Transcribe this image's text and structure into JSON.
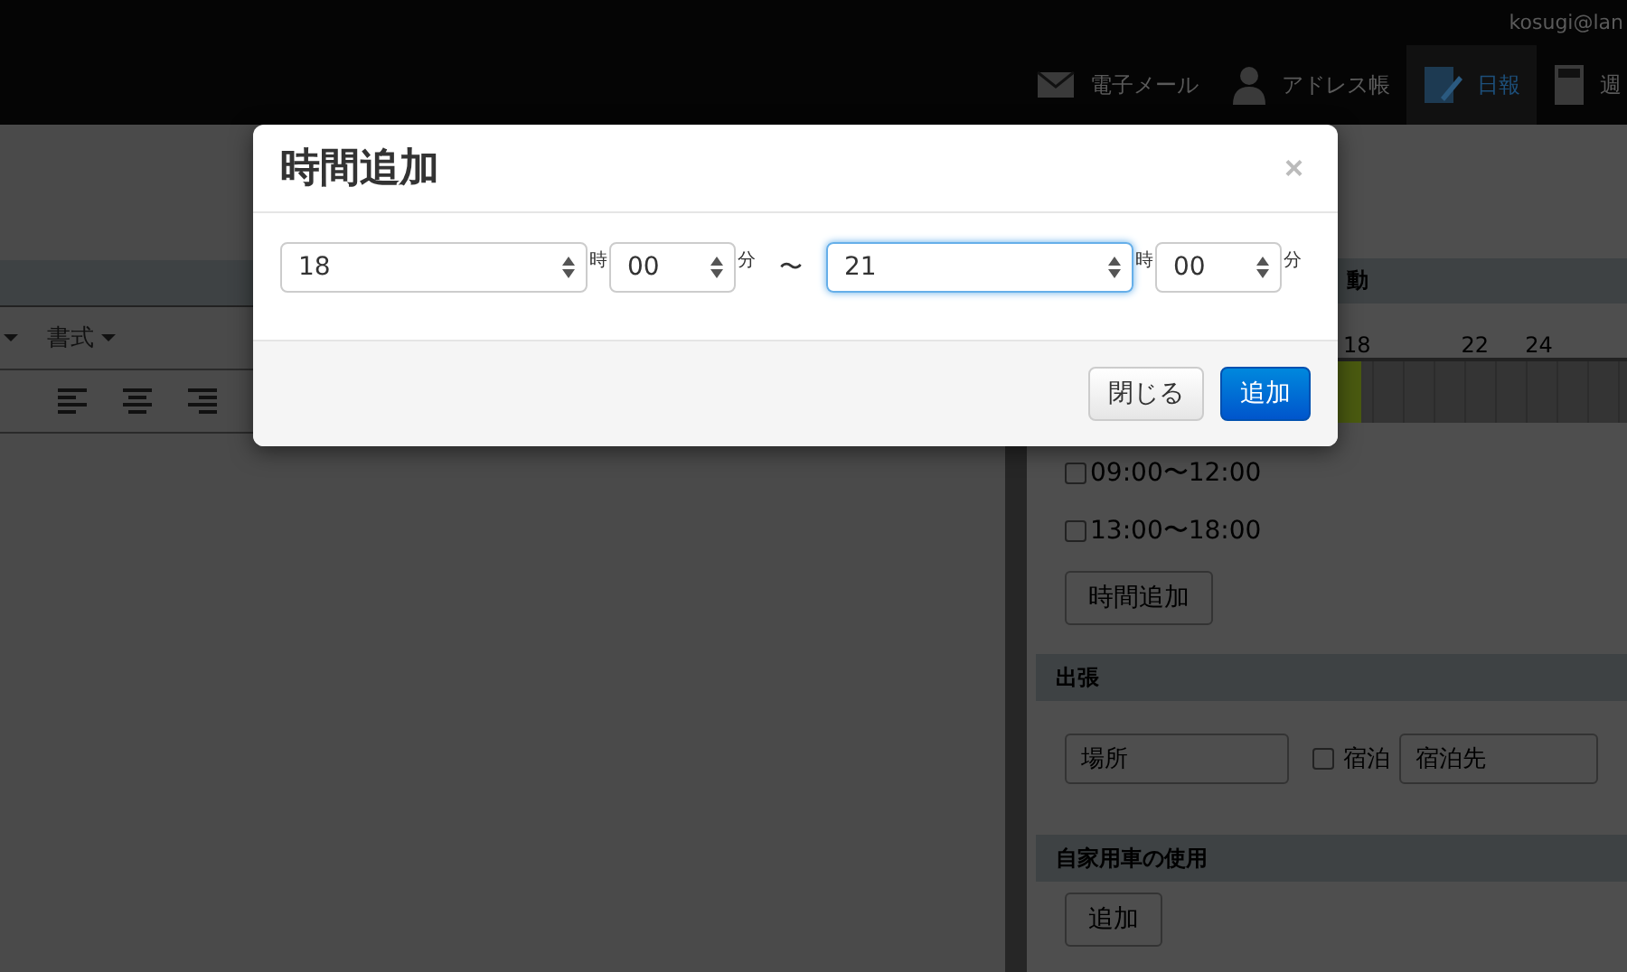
{
  "topbar": {
    "user": "kosugi@lan",
    "nav": [
      {
        "label": "電子メール",
        "kind": "mail",
        "selected": false
      },
      {
        "label": "アドレス帳",
        "kind": "person",
        "selected": false
      },
      {
        "label": "日報",
        "kind": "pen",
        "selected": true
      },
      {
        "label": "週",
        "kind": "calc",
        "selected": false
      }
    ]
  },
  "editor": {
    "toolbar": [
      {
        "kind": "caret"
      },
      {
        "label": "書式",
        "kind": "menu"
      }
    ]
  },
  "side": {
    "header": "動",
    "timeline": {
      "labels": [
        "18",
        "22",
        "24"
      ],
      "level": 0.55
    },
    "slots": [
      {
        "label": "09:00〜12:00",
        "checked": false
      },
      {
        "label": "13:00〜18:00",
        "checked": false
      }
    ],
    "add_time_button": "時間追加",
    "trip": {
      "header": "出張",
      "place_placeholder": "場所",
      "stay_label": "宿泊",
      "stay_checked": false,
      "stay_placeholder": "宿泊先"
    },
    "car": {
      "header": "自家用車の使用",
      "add_button": "追加"
    }
  },
  "modal": {
    "title": "時間追加",
    "close": "×",
    "fields": [
      {
        "value": "18",
        "unit": "時",
        "kind": "hour",
        "focused": false
      },
      {
        "value": "00",
        "unit": "分",
        "kind": "minute",
        "focused": false
      },
      {
        "value": "21",
        "unit": "時",
        "kind": "hour",
        "focused": true
      },
      {
        "value": "00",
        "unit": "分",
        "kind": "minute",
        "focused": false
      }
    ],
    "separator": "〜",
    "buttons": [
      {
        "label": "閉じる",
        "kind": "default"
      },
      {
        "label": "追加",
        "kind": "primary"
      }
    ]
  }
}
